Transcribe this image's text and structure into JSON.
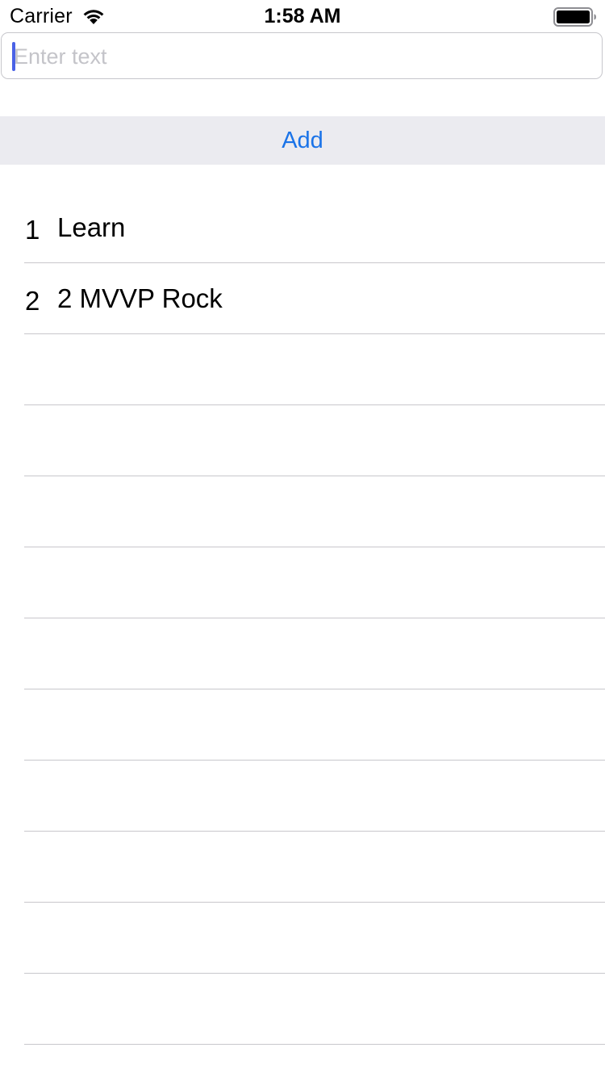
{
  "status_bar": {
    "carrier": "Carrier",
    "time": "1:58 AM",
    "wifi_icon": "wifi-icon",
    "battery_icon": "battery-icon"
  },
  "input": {
    "placeholder": "Enter text",
    "value": ""
  },
  "add_button": {
    "label": "Add",
    "color": "#1a73e8",
    "background": "#ebebf0"
  },
  "table": {
    "rows": [
      {
        "number": "1",
        "text": "Learn"
      },
      {
        "number": "2",
        "text": "2 MVVP Rock"
      },
      {
        "number": "",
        "text": ""
      },
      {
        "number": "",
        "text": ""
      },
      {
        "number": "",
        "text": ""
      },
      {
        "number": "",
        "text": ""
      },
      {
        "number": "",
        "text": ""
      },
      {
        "number": "",
        "text": ""
      },
      {
        "number": "",
        "text": ""
      },
      {
        "number": "",
        "text": ""
      },
      {
        "number": "",
        "text": ""
      },
      {
        "number": "",
        "text": ""
      }
    ]
  }
}
